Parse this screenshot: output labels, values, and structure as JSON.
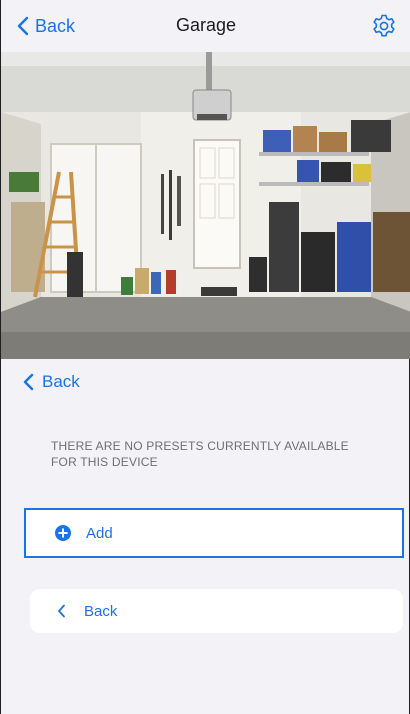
{
  "navbar": {
    "back_label": "Back",
    "title": "Garage",
    "settings_icon": "gear-icon"
  },
  "camera_feed": {
    "subject": "Garage camera view"
  },
  "presets": {
    "back_label": "Back",
    "empty_message": "THERE ARE NO PRESETS CURRENTLY AVAILABLE FOR THIS DEVICE",
    "add_label": "Add",
    "add_icon": "plus-circle-icon",
    "bottom_back_label": "Back"
  },
  "colors": {
    "accent": "#1a73e8",
    "background": "#f2f2f7",
    "card": "#ffffff",
    "message_text": "#6e6e73"
  }
}
